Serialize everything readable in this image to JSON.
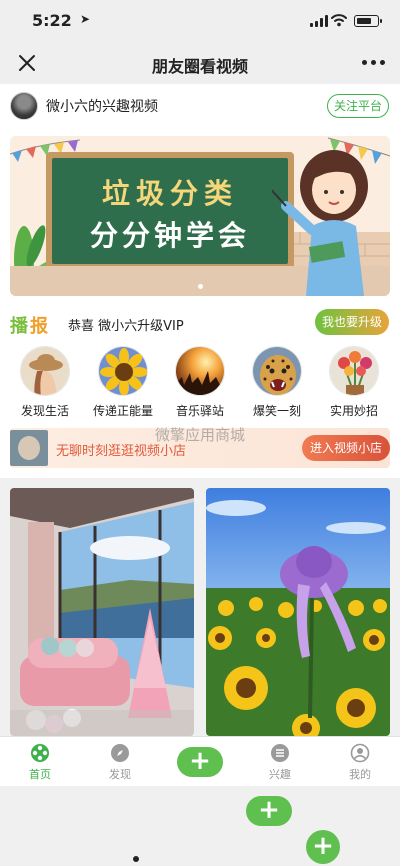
{
  "status_bar": {
    "time": "5:22",
    "location_glyph": "➤"
  },
  "nav": {
    "title": "朋友圈看视频",
    "close_icon": "close-icon",
    "more_icon": "more-icon"
  },
  "platform": {
    "name": "微小六的兴趣视频",
    "follow_label": "关注平台"
  },
  "banner": {
    "line1": "垃圾分类",
    "line2": "分分钟学会",
    "page_count": 1,
    "active_page": 1
  },
  "notice": {
    "badge_1": "播",
    "badge_2": "报",
    "text": "恭喜 微小六升级VIP",
    "button": "我也要升级"
  },
  "categories": [
    {
      "label": "发现生活",
      "icon": "girl-hat-photo"
    },
    {
      "label": "传递正能量",
      "icon": "sunflower-photo"
    },
    {
      "label": "音乐驿站",
      "icon": "concert-photo"
    },
    {
      "label": "爆笑一刻",
      "icon": "leopard-photo"
    },
    {
      "label": "实用妙招",
      "icon": "flowers-photo"
    }
  ],
  "shop": {
    "text": "无聊时刻逛逛视频小店",
    "button": "进入视频小店"
  },
  "watermark": "微擎应用商城",
  "videos": [
    {
      "subject": "pink-room-seaside",
      "accent": "#f2a7b8"
    },
    {
      "subject": "sunflower-field-hat",
      "accent": "#f5c419"
    }
  ],
  "tabbar": {
    "items": [
      {
        "label": "首页",
        "icon": "film-reel-icon",
        "active": true
      },
      {
        "label": "发现",
        "icon": "compass-icon",
        "active": false
      },
      {
        "label": "",
        "icon": "plus-icon",
        "active": false
      },
      {
        "label": "兴趣",
        "icon": "list-icon",
        "active": false
      },
      {
        "label": "我的",
        "icon": "user-icon",
        "active": false
      }
    ]
  },
  "colors": {
    "brand_green": "#3db24a",
    "shop_orange": "#e25a3c"
  }
}
